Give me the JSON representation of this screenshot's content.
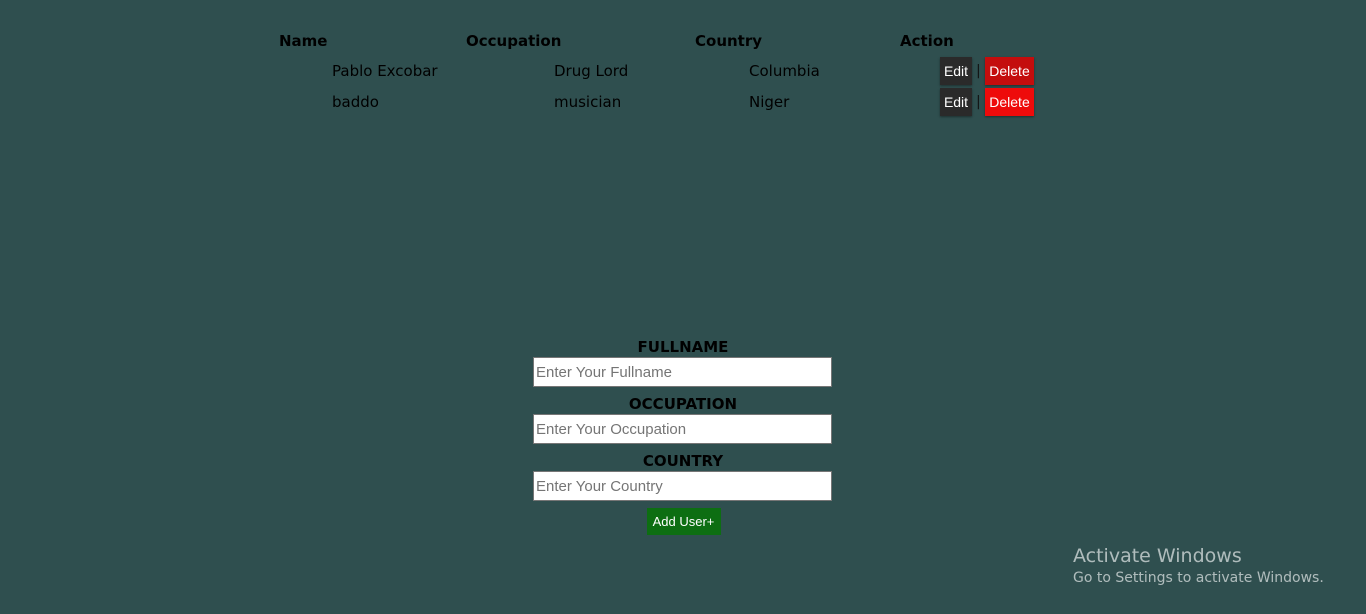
{
  "table": {
    "headers": {
      "name": "Name",
      "occupation": "Occupation",
      "country": "Country",
      "action": "Action"
    },
    "rows": [
      {
        "name": "Pablo Excobar",
        "occupation": "Drug Lord",
        "country": "Columbia",
        "edit_label": "Edit",
        "separator": "|",
        "delete_label": "Delete"
      },
      {
        "name": "baddo",
        "occupation": "musician",
        "country": "Niger",
        "edit_label": "Edit",
        "separator": "|",
        "delete_label": "Delete"
      }
    ]
  },
  "form": {
    "fullname": {
      "label": "FULLNAME",
      "placeholder": "Enter Your Fullname",
      "value": ""
    },
    "occupation": {
      "label": "OCCUPATION",
      "placeholder": "Enter Your Occupation",
      "value": ""
    },
    "country": {
      "label": "COUNTRY",
      "placeholder": "Enter Your Country",
      "value": ""
    },
    "submit_label": "Add User+"
  },
  "watermark": {
    "title": "Activate Windows",
    "subtitle": "Go to Settings to activate Windows."
  },
  "colors": {
    "background": "#2f4f4f",
    "edit_button": "#2a2a2a",
    "delete_button": "#e00b0b",
    "add_button": "#0d6e12"
  }
}
